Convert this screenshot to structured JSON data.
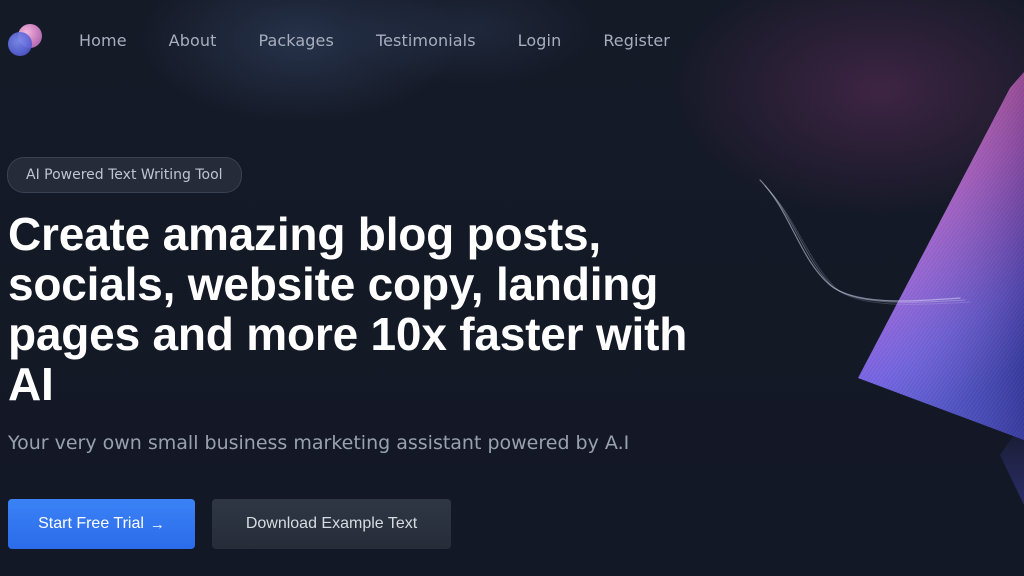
{
  "nav": {
    "logo_icon": "two-overlapping-orbs-logo",
    "items": [
      {
        "label": "Home"
      },
      {
        "label": "About"
      },
      {
        "label": "Packages"
      },
      {
        "label": "Testimonials"
      },
      {
        "label": "Login"
      },
      {
        "label": "Register"
      }
    ]
  },
  "hero": {
    "badge": "AI Powered Text Writing Tool",
    "headline": "Create amazing blog posts, socials, website copy, landing pages and more 10x faster with AI",
    "subtitle": "Your very own small business marketing assistant powered by A.I",
    "primary_button": "Start Free Trial",
    "primary_button_arrow": "→",
    "secondary_button": "Download Example Text"
  },
  "colors": {
    "background": "#141926",
    "primary": "#3b82f6",
    "secondary_button": "#2a313d",
    "accent_pink": "#e86bb4",
    "accent_violet": "#6b5ae6"
  }
}
